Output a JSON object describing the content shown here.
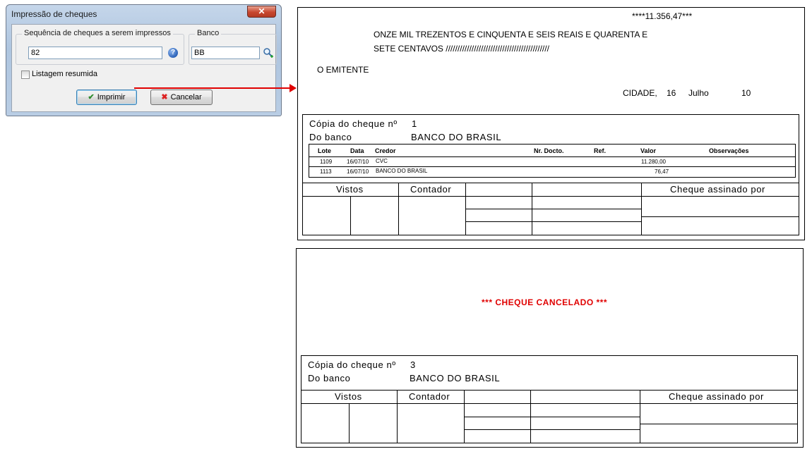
{
  "dialog": {
    "title": "Impressão de cheques",
    "close_label": "✕",
    "sequence_group_label": "Sequência de cheques a serem impressos",
    "sequence_value": "82",
    "bank_group_label": "Banco",
    "bank_value": "BB",
    "summary_checkbox_label": "Listagem resumida",
    "summary_checked": false,
    "print_button": "Imprimir",
    "cancel_button": "Cancelar",
    "icons": {
      "help": "help-icon",
      "bank_lookup": "search-icon",
      "print": "check-icon",
      "cancel": "x-icon"
    }
  },
  "arrow_color": "#e00000",
  "cheque1": {
    "amount": "****11.356,47***",
    "amount_words_line1": "ONZE MIL TREZENTOS E CINQUENTA E SEIS REAIS E QUARENTA E",
    "amount_words_line2": "SETE CENTAVOS ////////////////////////////////////////////",
    "payee": "O EMITENTE",
    "city": "CIDADE,",
    "day": "16",
    "month": "Julho",
    "year": "10",
    "copy_label": "Cópia do cheque nº",
    "copy_number": "1",
    "bank_label": "Do banco",
    "bank_name": "BANCO DO BRASIL",
    "table_headers": [
      "Lote",
      "Data",
      "Credor",
      "Nr. Docto.",
      "Ref.",
      "Valor",
      "Observações"
    ],
    "rows": [
      {
        "lote": "1109",
        "data": "16/07/10",
        "credor": "CVC",
        "valor": "11.280,00"
      },
      {
        "lote": "1113",
        "data": "16/07/10",
        "credor": "BANCO DO BRASIL",
        "valor": "76,47"
      }
    ],
    "sign_headers": {
      "vistos": "Vistos",
      "contador": "Contador",
      "assinado": "Cheque assinado por"
    }
  },
  "cheque2": {
    "cancel_message": "*** CHEQUE CANCELADO ***",
    "copy_label": "Cópia do cheque nº",
    "copy_number": "3",
    "bank_label": "Do banco",
    "bank_name": "BANCO DO BRASIL",
    "sign_headers": {
      "vistos": "Vistos",
      "contador": "Contador",
      "assinado": "Cheque assinado por"
    }
  }
}
